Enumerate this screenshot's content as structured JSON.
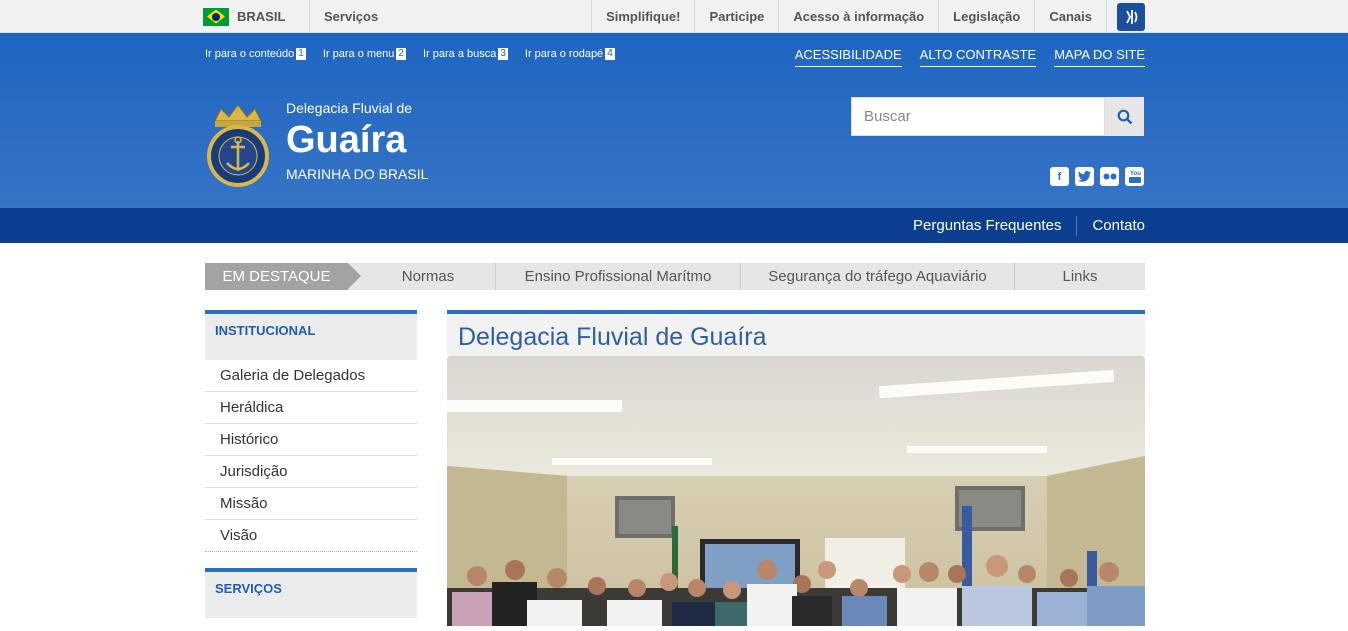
{
  "gov_bar": {
    "brand": "BRASIL",
    "services": "Serviços",
    "links": [
      "Simplifique!",
      "Participe",
      "Acesso à informação",
      "Legislação",
      "Canais"
    ]
  },
  "skip_links": [
    {
      "label": "Ir para o conteúdo",
      "key": "1"
    },
    {
      "label": "Ir para o menu",
      "key": "2"
    },
    {
      "label": "Ir para a busca",
      "key": "3"
    },
    {
      "label": "Ir para o rodapé",
      "key": "4"
    }
  ],
  "accessibility_links": [
    "ACESSIBILIDADE",
    "ALTO CONTRASTE",
    "MAPA DO SITE"
  ],
  "header": {
    "subtitle_top": "Delegacia Fluvial de",
    "title": "Guaíra",
    "subtitle_bottom": "MARINHA DO BRASIL",
    "logo_text": "MARINHA DO BRASIL"
  },
  "search": {
    "placeholder": "Buscar"
  },
  "social_icons": [
    "facebook-icon",
    "twitter-icon",
    "flickr-icon",
    "youtube-icon"
  ],
  "service_bar": [
    "Perguntas Frequentes",
    "Contato"
  ],
  "top_menu": {
    "highlight": "EM DESTAQUE",
    "items": [
      "Normas",
      "Ensino Profissional Marítmo",
      "Segurança do tráfego Aquaviário",
      "Links"
    ]
  },
  "sidebar": {
    "section1": "INSTITUCIONAL",
    "items": [
      "Galeria de Delegados",
      "Heráldica",
      "Histórico",
      "Jurisdição",
      "Missão",
      "Visão"
    ],
    "section2": "SERVIÇOS"
  },
  "content": {
    "title": "Delegacia Fluvial de Guaíra"
  },
  "colors": {
    "primary": "#2d6ec4",
    "dark": "#0c3f8f",
    "gov_bar": "#f1f1f1"
  }
}
